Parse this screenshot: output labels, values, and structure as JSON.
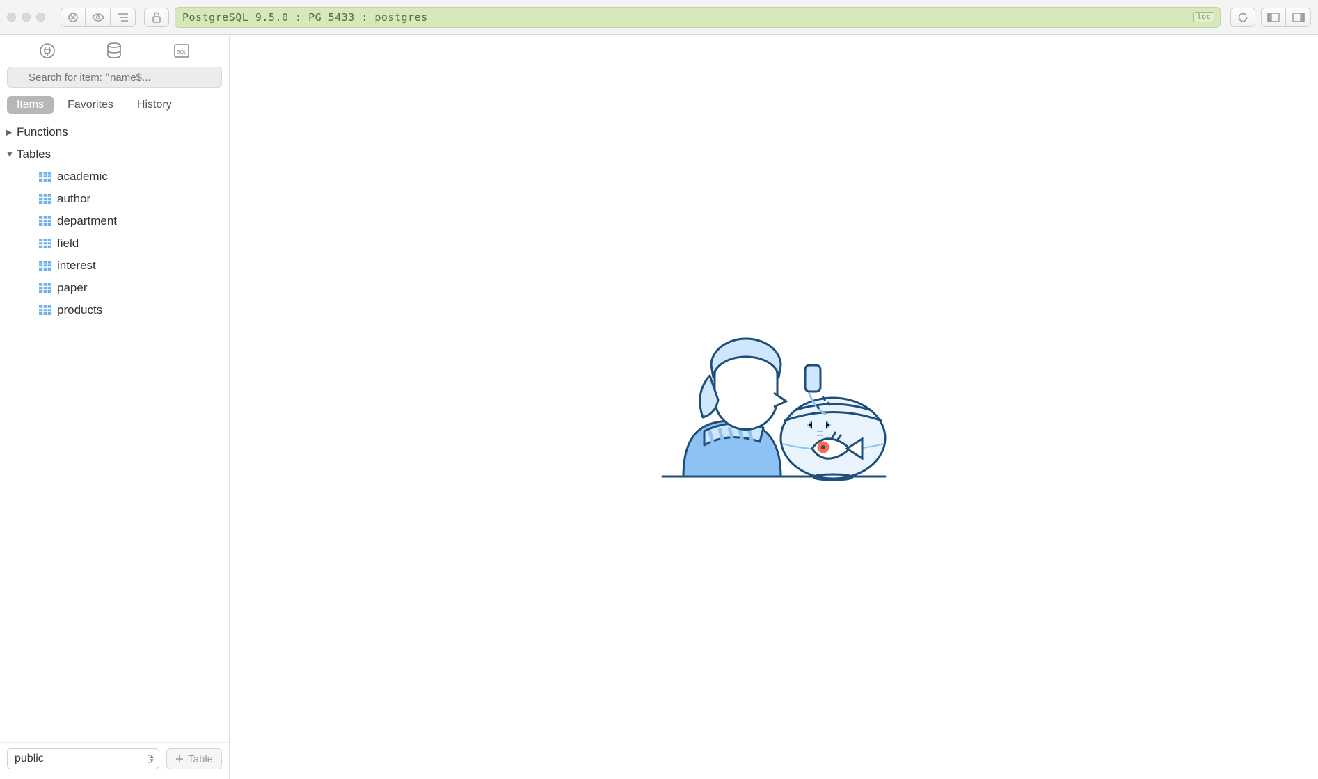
{
  "connection": {
    "label": "PostgreSQL 9.5.0 : PG 5433 : postgres",
    "loc_badge": "loc"
  },
  "search": {
    "placeholder": "Search for item: ^name$..."
  },
  "sidebar_tabs": {
    "items": "Items",
    "favorites": "Favorites",
    "history": "History",
    "active": "items"
  },
  "tree": {
    "sections": [
      {
        "id": "functions",
        "label": "Functions",
        "expanded": false
      },
      {
        "id": "tables",
        "label": "Tables",
        "expanded": true
      }
    ],
    "tables": [
      "academic",
      "author",
      "department",
      "field",
      "interest",
      "paper",
      "products"
    ]
  },
  "footer": {
    "schema": "public",
    "add_table": "Table"
  }
}
